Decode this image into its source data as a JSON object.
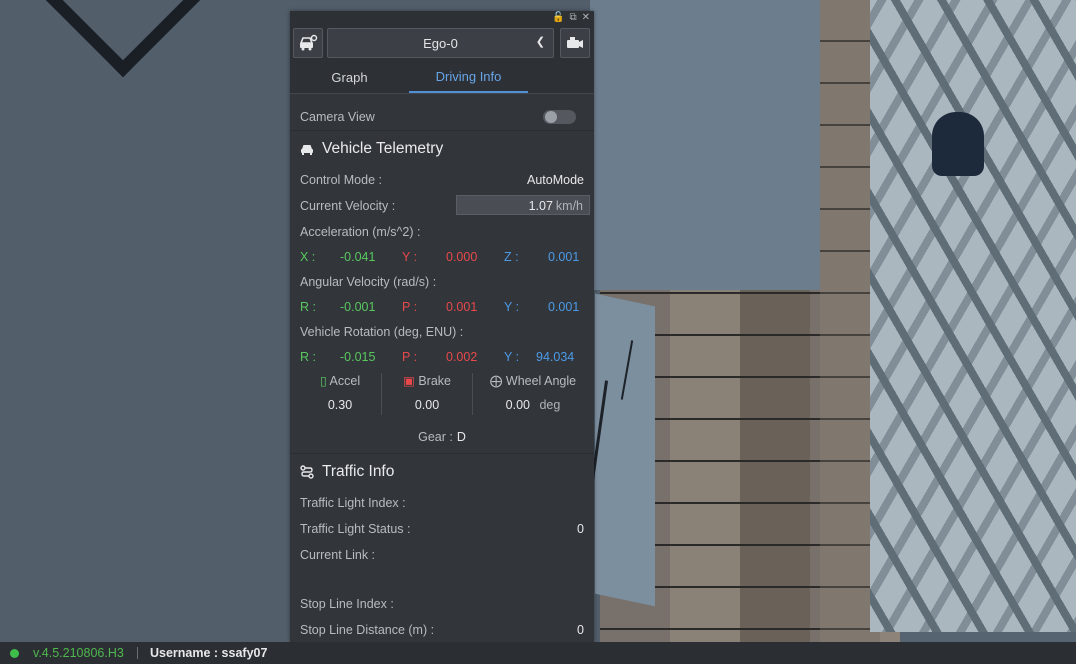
{
  "panel": {
    "vehicle_select": "Ego-0",
    "tabs": [
      {
        "label": "Graph",
        "active": false
      },
      {
        "label": "Driving Info",
        "active": true
      }
    ],
    "camera_view_label": "Camera View",
    "camera_view_on": false,
    "telemetry": {
      "title": "Vehicle Telemetry",
      "control_mode_label": "Control Mode :",
      "control_mode_value": "AutoMode",
      "velocity_label": "Current Velocity :",
      "velocity_value": "1.07",
      "velocity_unit": "km/h",
      "accel_label": "Acceleration (m/s^2) :",
      "accel": {
        "x_label": "X :",
        "x": "-0.041",
        "y_label": "Y :",
        "y": "0.000",
        "z_label": "Z :",
        "z": "0.001"
      },
      "angvel_label": "Angular Velocity (rad/s) :",
      "angvel": {
        "r_label": "R :",
        "r": "-0.001",
        "p_label": "P :",
        "p": "0.001",
        "y_label": "Y :",
        "y": "0.001"
      },
      "rotation_label": "Vehicle Rotation (deg, ENU) :",
      "rotation": {
        "r_label": "R :",
        "r": "-0.015",
        "p_label": "P :",
        "p": "0.002",
        "y_label": "Y :",
        "y": "94.034"
      },
      "accel_pedal_label": "Accel",
      "accel_pedal_value": "0.30",
      "brake_label": "Brake",
      "brake_value": "0.00",
      "wheel_label": "Wheel Angle",
      "wheel_value": "0.00",
      "wheel_unit": "deg",
      "gear_label": "Gear :",
      "gear_value": "D"
    },
    "traffic": {
      "title": "Traffic Info",
      "light_index_label": "Traffic Light Index :",
      "light_index_value": "",
      "light_status_label": "Traffic Light Status :",
      "light_status_value": "0",
      "current_link_label": "Current Link :",
      "current_link_value": "",
      "stop_line_index_label": "Stop Line Index :",
      "stop_line_index_value": "",
      "stop_line_distance_label": "Stop Line Distance (m) :",
      "stop_line_distance_value": "0"
    }
  },
  "statusbar": {
    "version": "v.4.5.210806.H3",
    "username": "Username : ssafy07"
  },
  "colors": {
    "accent": "#4f8fd6",
    "x_green": "#58c85e",
    "y_red": "#e8484a",
    "z_blue": "#4c9be8",
    "status_green": "#3fbf4a"
  },
  "icons": [
    "lock-icon",
    "popout-icon",
    "close-icon",
    "car-settings-icon",
    "chevron-down-icon",
    "camera-icon",
    "car-icon",
    "accel-pedal-icon",
    "brake-icon",
    "steering-wheel-icon",
    "route-icon",
    "status-dot-icon"
  ]
}
